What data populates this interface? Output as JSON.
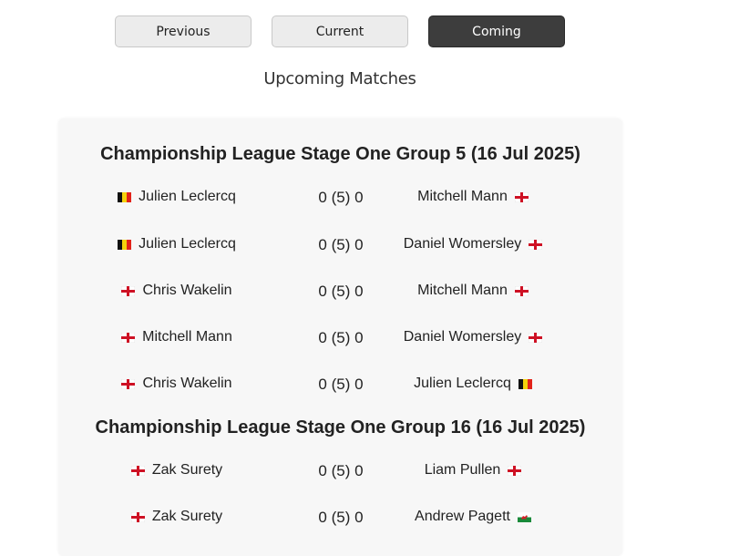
{
  "tabs": [
    {
      "label": "Previous",
      "active": false
    },
    {
      "label": "Current",
      "active": false
    },
    {
      "label": "Coming",
      "active": true
    }
  ],
  "section_title": "Upcoming Matches",
  "groups": [
    {
      "title": "Championship League Stage One Group 5 (16 Jul 2025)",
      "matches": [
        {
          "home": "Julien Leclercq",
          "home_flag": "belgium-flag-icon",
          "score": "0 (5) 0",
          "away": "Mitchell Mann",
          "away_flag": "england-flag-icon"
        },
        {
          "home": "Julien Leclercq",
          "home_flag": "belgium-flag-icon",
          "score": "0 (5) 0",
          "away": "Daniel Womersley",
          "away_flag": "england-flag-icon"
        },
        {
          "home": "Chris Wakelin",
          "home_flag": "england-flag-icon",
          "score": "0 (5) 0",
          "away": "Mitchell Mann",
          "away_flag": "england-flag-icon"
        },
        {
          "home": "Mitchell Mann",
          "home_flag": "england-flag-icon",
          "score": "0 (5) 0",
          "away": "Daniel Womersley",
          "away_flag": "england-flag-icon"
        },
        {
          "home": "Chris Wakelin",
          "home_flag": "england-flag-icon",
          "score": "0 (5) 0",
          "away": "Julien Leclercq",
          "away_flag": "belgium-flag-icon"
        }
      ]
    },
    {
      "title": "Championship League Stage One Group 16 (16 Jul 2025)",
      "matches": [
        {
          "home": "Zak Surety",
          "home_flag": "england-flag-icon",
          "score": "0 (5) 0",
          "away": "Liam Pullen",
          "away_flag": "england-flag-icon"
        },
        {
          "home": "Zak Surety",
          "home_flag": "england-flag-icon",
          "score": "0 (5) 0",
          "away": "Andrew Pagett",
          "away_flag": "wales-flag-icon"
        }
      ]
    }
  ],
  "colors": {
    "active_tab": "#3d3d3d",
    "tab": "#ececec",
    "panel": "#f7f7f7"
  }
}
